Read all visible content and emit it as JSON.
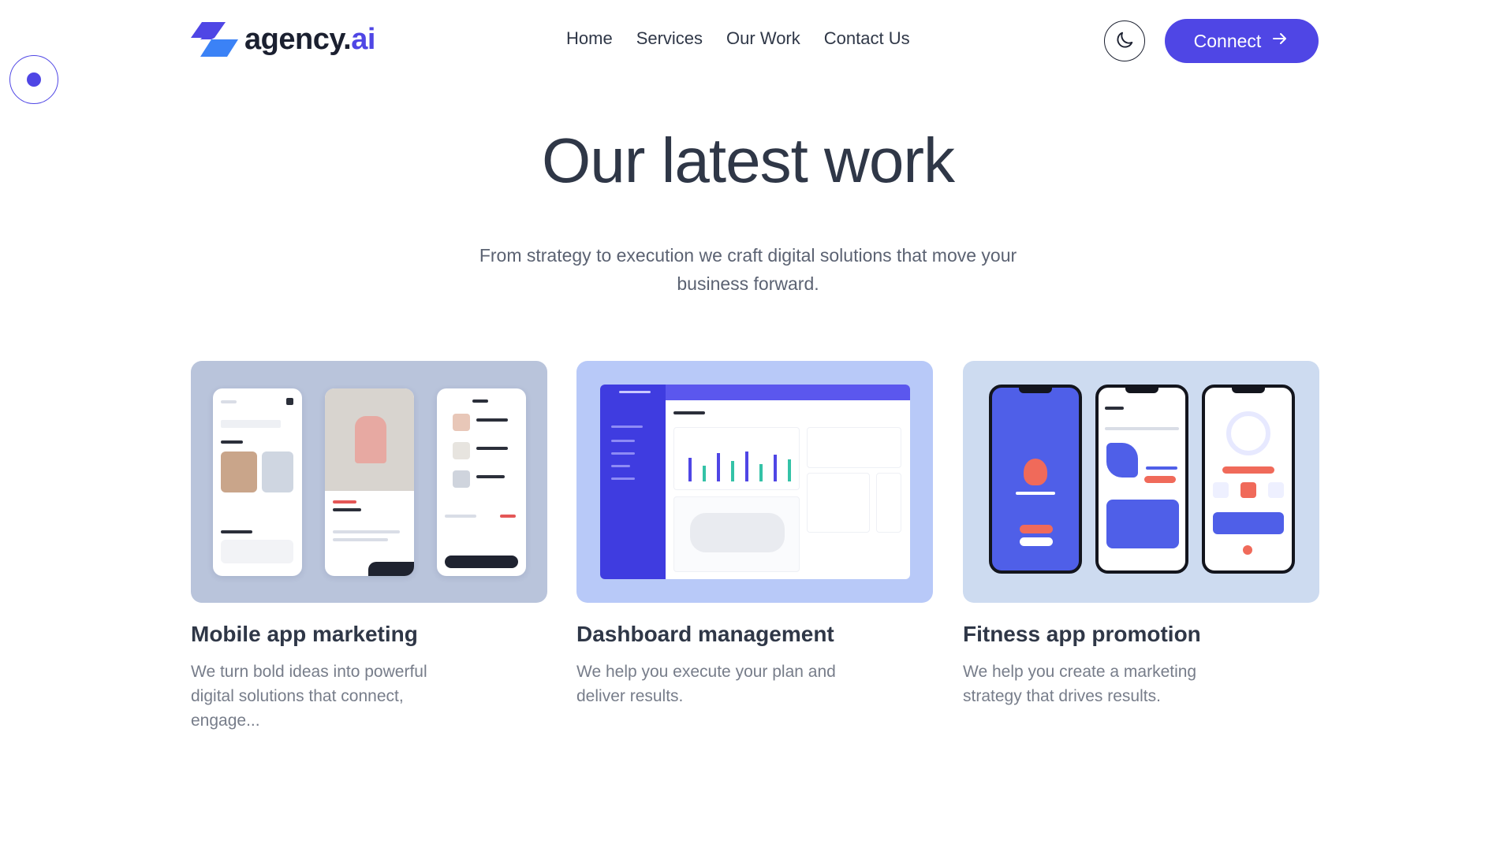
{
  "header": {
    "logo_text": "agency.",
    "logo_tld": "ai",
    "nav": [
      "Home",
      "Services",
      "Our Work",
      "Contact Us"
    ],
    "theme_icon": "moon-icon",
    "connect_label": "Connect",
    "connect_icon": "arrow-right-icon",
    "accent_color": "#4f46e5"
  },
  "hero": {
    "title": "Our latest work",
    "subtitle": "From strategy to execution we craft digital solutions that move your business forward."
  },
  "cards": [
    {
      "title": "Mobile app marketing",
      "description": "We turn bold ideas into powerful digital solutions that connect, engage...",
      "bg_color": "#b9c4db"
    },
    {
      "title": "Dashboard management",
      "description": "We help you execute your plan and deliver results.",
      "bg_color": "#b8c9f8"
    },
    {
      "title": "Fitness app promotion",
      "description": "We help you create a marketing strategy that drives results.",
      "bg_color": "#cddbf0"
    }
  ]
}
